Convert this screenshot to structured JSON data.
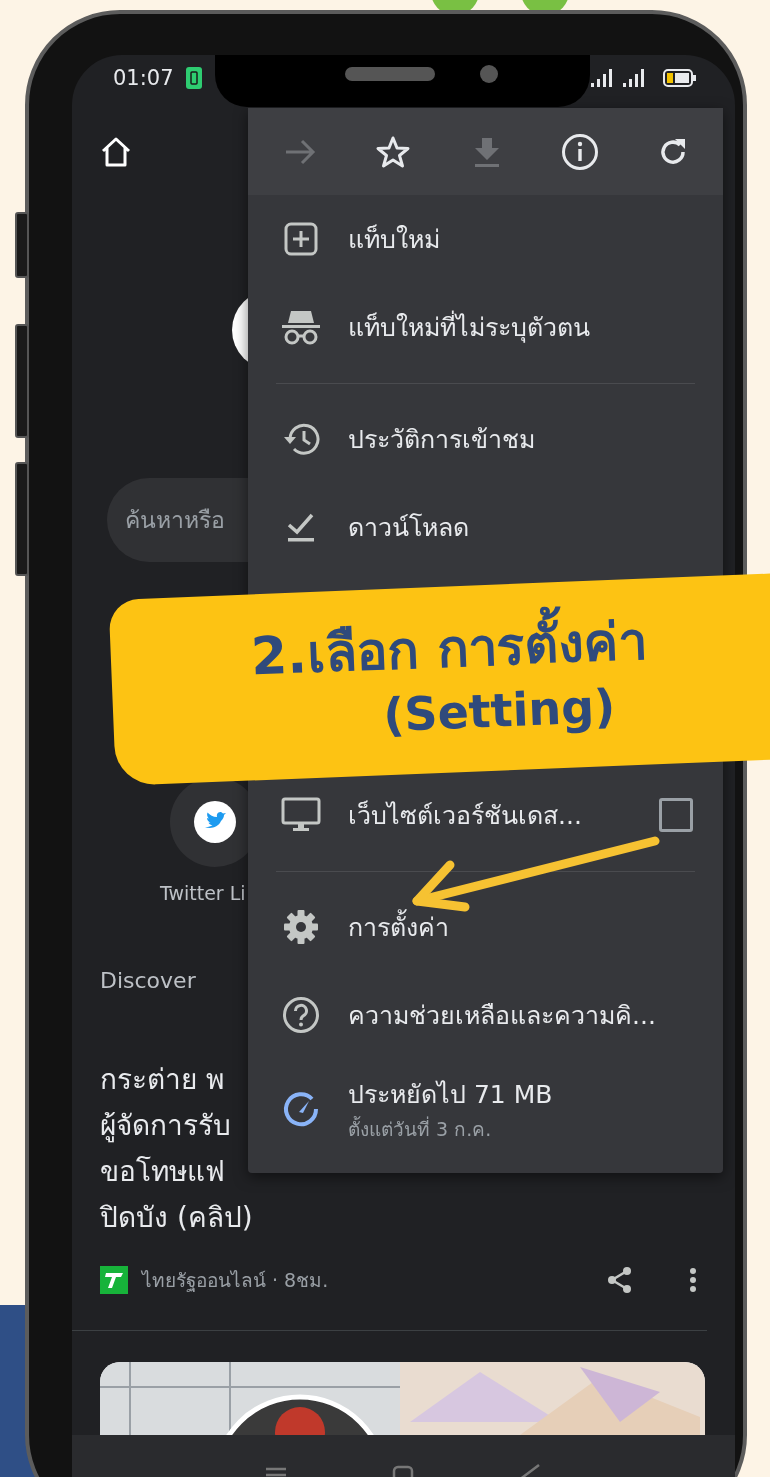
{
  "status_bar": {
    "time": "01:07"
  },
  "home": {
    "search": {
      "placeholder": "ค้นหาหรือ"
    },
    "shortcuts": [
      {
        "label": "Twitter Li"
      }
    ],
    "discover": {
      "title": "Discover"
    },
    "article": {
      "title_lines": [
        "กระต่าย พ",
        "ผู้จัดการรับ",
        "ขอโทษแฟ",
        "ปิดบัง (คลิป)"
      ],
      "source": "ไทยรัฐออนไลน์ · 8ชม."
    }
  },
  "menu": {
    "toolbar": [
      {
        "kind": "forward",
        "disabled": true
      },
      {
        "kind": "bookmark",
        "disabled": false
      },
      {
        "kind": "download",
        "disabled": true
      },
      {
        "kind": "info",
        "disabled": false
      },
      {
        "kind": "reload",
        "disabled": false
      }
    ],
    "items": [
      {
        "kind": "new-tab",
        "label": "แท็บใหม่"
      },
      {
        "kind": "incognito",
        "label": "แท็บใหม่ที่ไม่ระบุตัวตน"
      },
      {
        "kind": "divider"
      },
      {
        "kind": "history",
        "label": "ประวัติการเข้าชม"
      },
      {
        "kind": "downloads",
        "label": "ดาวน์โหลด"
      },
      {
        "kind": "gap"
      },
      {
        "kind": "desktop-site",
        "label": "เว็บไซต์เวอร์ชันเดส...",
        "checked": false
      },
      {
        "kind": "divider"
      },
      {
        "kind": "settings",
        "label": "การตั้งค่า"
      },
      {
        "kind": "help",
        "label": "ความช่วยเหลือและความคิ..."
      },
      {
        "kind": "data-saver",
        "label": "ประหยัดไป 71 MB",
        "sublabel": "ตั้งแต่วันที่ 3 ก.ค."
      }
    ]
  },
  "callout": {
    "lines": [
      "2.เลือก การตั้งค่า",
      "(Setting)"
    ]
  }
}
